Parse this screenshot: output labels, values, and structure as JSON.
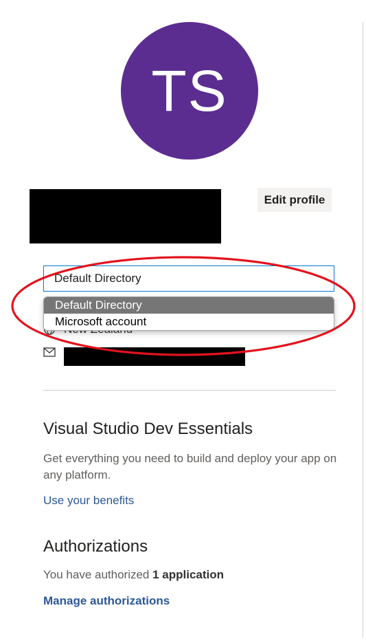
{
  "profile": {
    "initials": "TS",
    "avatar_color": "#5c2d91",
    "edit_profile_label": "Edit profile"
  },
  "directory": {
    "selected": "Default Directory",
    "options": [
      "Default Directory",
      "Microsoft account"
    ],
    "partially_hidden_text": "New Zealand"
  },
  "contact": {
    "email_icon": "mail-icon"
  },
  "dev_essentials": {
    "title": "Visual Studio Dev Essentials",
    "description": "Get everything you need to build and deploy your app on any platform.",
    "link": "Use your benefits"
  },
  "authorizations": {
    "title": "Authorizations",
    "text_prefix": "You have authorized",
    "count_text": "1 application",
    "link": "Manage authorizations"
  },
  "colors": {
    "link": "#2b579a",
    "focus_border": "#0078d4",
    "annotation": "#e3121d"
  }
}
